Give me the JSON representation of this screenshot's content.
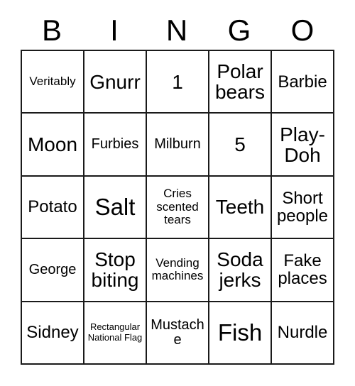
{
  "card": {
    "title": "BINGO",
    "header_letters": [
      "B",
      "I",
      "N",
      "G",
      "O"
    ],
    "grid_columns": 5,
    "grid_rows": 5,
    "colors": {
      "background": "#ffffff",
      "border": "#1a1a1a",
      "text": "#000000"
    },
    "rows": [
      [
        {
          "text": "Veritably",
          "size": "fs-sm"
        },
        {
          "text": "Gnurr",
          "size": "fs-xl"
        },
        {
          "text": "1",
          "size": "fs-xl"
        },
        {
          "text": "Polar bears",
          "size": "fs-xl"
        },
        {
          "text": "Barbie",
          "size": "fs-lg"
        }
      ],
      [
        {
          "text": "Moon",
          "size": "fs-xl"
        },
        {
          "text": "Furbies",
          "size": "fs-md"
        },
        {
          "text": "Milburn",
          "size": "fs-md"
        },
        {
          "text": "5",
          "size": "fs-xl"
        },
        {
          "text": "Play-Doh",
          "size": "fs-xl"
        }
      ],
      [
        {
          "text": "Potato",
          "size": "fs-lg"
        },
        {
          "text": "Salt",
          "size": "fs-xxl"
        },
        {
          "text": "Cries scented tears",
          "size": "fs-sm"
        },
        {
          "text": "Teeth",
          "size": "fs-xl"
        },
        {
          "text": "Short people",
          "size": "fs-lg"
        }
      ],
      [
        {
          "text": "George",
          "size": "fs-md"
        },
        {
          "text": "Stop biting",
          "size": "fs-xl"
        },
        {
          "text": "Vending machines",
          "size": "fs-sm"
        },
        {
          "text": "Soda jerks",
          "size": "fs-xl"
        },
        {
          "text": "Fake places",
          "size": "fs-lg"
        }
      ],
      [
        {
          "text": "Sidney",
          "size": "fs-lg"
        },
        {
          "text": "Rectangular National Flag",
          "size": "fs-xs"
        },
        {
          "text": "Mustache",
          "size": "fs-md"
        },
        {
          "text": "Fish",
          "size": "fs-xxl"
        },
        {
          "text": "Nurdle",
          "size": "fs-lg"
        }
      ]
    ]
  }
}
